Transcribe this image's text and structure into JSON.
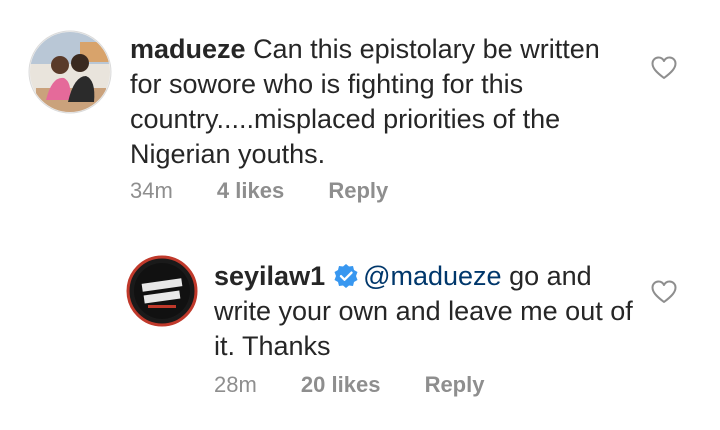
{
  "comments": [
    {
      "username": "madueze",
      "text": "Can this epistolary be written for sowore who is fighting for this country.....misplaced priorities of the Nigerian youths.",
      "time": "34m",
      "likes": "4 likes",
      "reply_label": "Reply",
      "verified": false
    },
    {
      "username": "seyilaw1",
      "mention": "@madueze",
      "text": " go and write your own and leave me out of it. Thanks",
      "time": "28m",
      "likes": "20 likes",
      "reply_label": "Reply",
      "verified": true
    }
  ],
  "icons": {
    "like": "heart-outline-icon",
    "verified": "verified-badge-icon"
  },
  "colors": {
    "text": "#262626",
    "meta": "#8e8e8e",
    "mention": "#00376b",
    "verified": "#3897f0"
  }
}
